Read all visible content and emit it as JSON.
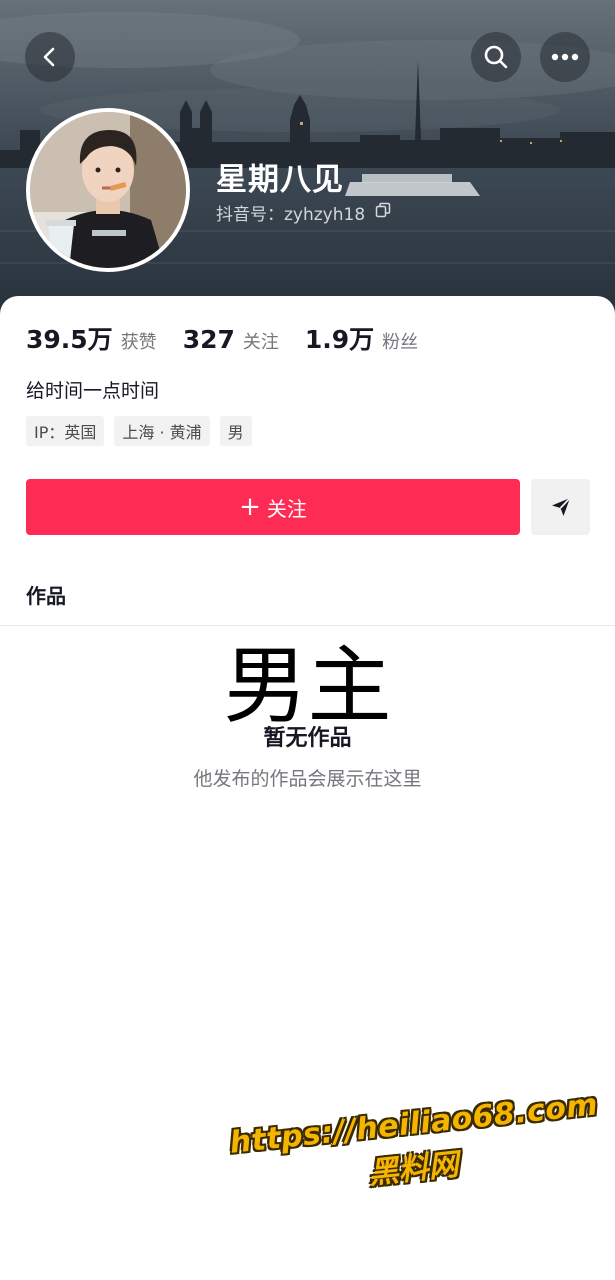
{
  "profile": {
    "name": "星期八见",
    "douyin_id": "抖音号：zyhzyh18",
    "bio": "给时间一点时间"
  },
  "stats": [
    {
      "value": "39.5万",
      "label": "获赞"
    },
    {
      "value": "327",
      "label": "关注"
    },
    {
      "value": "1.9万",
      "label": "粉丝"
    }
  ],
  "tags": [
    "IP：英国",
    "上海 · 黄浦",
    "男"
  ],
  "actions": {
    "follow_plus": "+",
    "follow_label": "关注"
  },
  "tabs": {
    "works": "作品"
  },
  "empty_state": {
    "overlay": "男主",
    "title": "暂无作品",
    "subtitle": "他发布的作品会展示在这里"
  },
  "watermark": {
    "url": "https://heiliao68.com",
    "name": "黑料网"
  },
  "icons": {
    "back": "chevron-left-icon",
    "search": "search-icon",
    "more": "more-dots-icon",
    "copy": "copy-icon",
    "share": "send-icon"
  },
  "colors": {
    "accent": "#fe2c55",
    "watermark": "#f5b400"
  }
}
